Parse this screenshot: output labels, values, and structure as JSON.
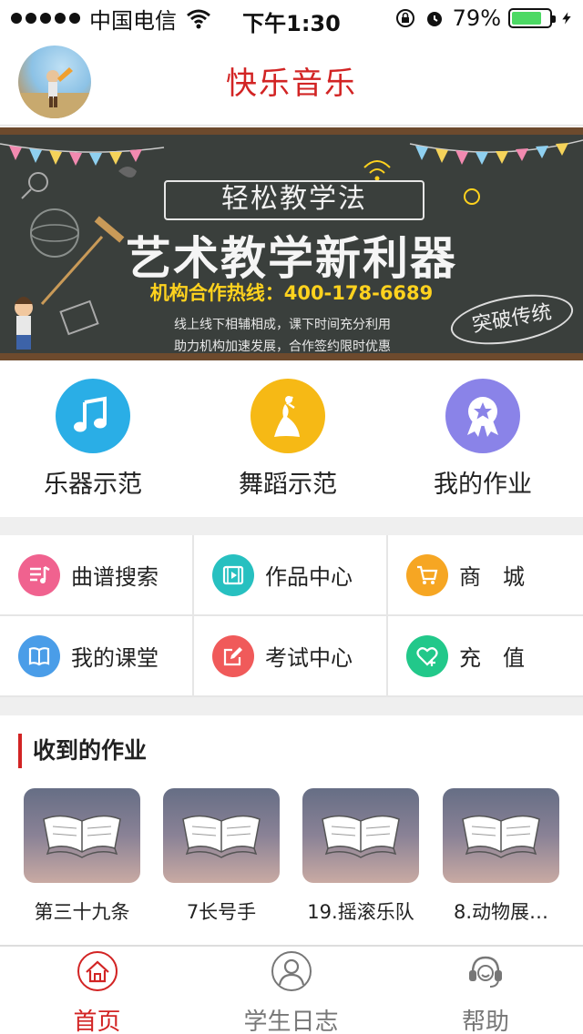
{
  "status_bar": {
    "carrier": "中国电信",
    "time": "下午1:30",
    "battery_percent": "79%",
    "battery_level": 0.79
  },
  "header": {
    "title": "快乐音乐"
  },
  "banner": {
    "subtitle": "轻松教学法",
    "title": "艺术教学新利器",
    "hotline": "机构合作热线：400-178-6689",
    "line1": "线上线下相辅相成，课下时间充分利用",
    "line2": "助力机构加速发展，合作签约限时优惠",
    "stamp": "突破传统"
  },
  "quick_actions": [
    {
      "label": "乐器示范",
      "icon": "music-note-icon",
      "color": "#2aaee6"
    },
    {
      "label": "舞蹈示范",
      "icon": "dancer-icon",
      "color": "#f6b915"
    },
    {
      "label": "我的作业",
      "icon": "award-badge-icon",
      "color": "#8a83e8"
    }
  ],
  "grid": [
    {
      "label": "曲谱搜索",
      "icon": "music-score-icon",
      "color": "#f0628f"
    },
    {
      "label": "作品中心",
      "icon": "video-play-icon",
      "color": "#27c0c0"
    },
    {
      "label": "商　城",
      "icon": "cart-icon",
      "color": "#f6a623"
    },
    {
      "label": "我的课堂",
      "icon": "book-open-icon",
      "color": "#4a9de8"
    },
    {
      "label": "考试中心",
      "icon": "edit-icon",
      "color": "#f05a5a"
    },
    {
      "label": "充　值",
      "icon": "recharge-icon",
      "color": "#22c88a"
    }
  ],
  "homework": {
    "title": "收到的作业",
    "items": [
      {
        "title": "第三十九条"
      },
      {
        "title": "7长号手"
      },
      {
        "title": "19.摇滚乐队"
      },
      {
        "title": "8.动物展…"
      }
    ]
  },
  "tabbar": [
    {
      "label": "首页",
      "icon": "home-icon",
      "active": true
    },
    {
      "label": "学生日志",
      "icon": "user-icon",
      "active": false
    },
    {
      "label": "帮助",
      "icon": "headset-icon",
      "active": false
    }
  ],
  "colors": {
    "accent": "#d22424",
    "divider": "#efefef"
  }
}
